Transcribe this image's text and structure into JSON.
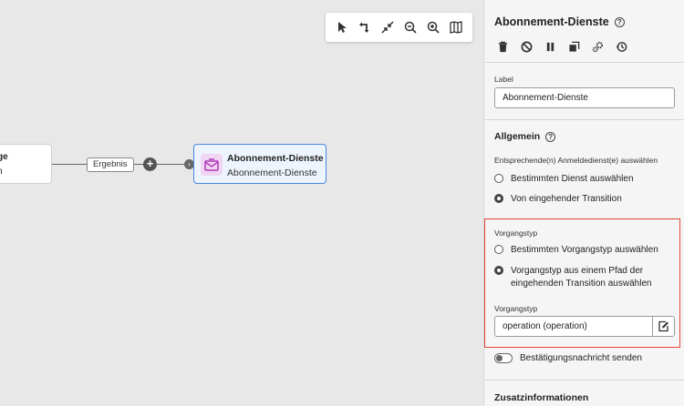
{
  "canvas": {
    "left_node": {
      "line1": "ge",
      "line2": "n"
    },
    "edge_label": "Ergebnis",
    "add_button": "+",
    "incoming_arrow": "›",
    "main_node": {
      "title": "Abonnement-Dienste",
      "subtitle": "Abonnement-Dienste",
      "icon": "envelope-subscription-icon"
    },
    "toolbar": [
      "select-pointer-icon",
      "reroute-icon",
      "collapse-icon",
      "zoom-out-icon",
      "zoom-in-icon",
      "minimap-icon"
    ]
  },
  "panel": {
    "title": "Abonnement-Dienste",
    "help_glyph": "?",
    "actions": [
      "delete-icon",
      "disable-icon",
      "pause-icon",
      "copy-icon",
      "settings-icon",
      "history-icon"
    ],
    "label_field": {
      "label": "Label",
      "value": "Abonnement-Dienste"
    },
    "general": {
      "title": "Allgemein",
      "service_label": "Entsprechende(n) Anmeldedienst(e) auswählen",
      "service_options": [
        {
          "label": "Bestimmten Dienst auswählen",
          "selected": false
        },
        {
          "label": "Von eingehender Transition",
          "selected": true
        }
      ]
    },
    "operation": {
      "title": "Vorgangstyp",
      "options": [
        {
          "label": "Bestimmten Vorgangstyp auswählen",
          "selected": false
        },
        {
          "label_line1": "Vorgangstyp aus einem Pfad der",
          "label_line2": "eingehenden Transition auswählen",
          "selected": true
        }
      ],
      "field_label": "Vorgangstyp",
      "field_value": "operation (operation)"
    },
    "confirmation_toggle": {
      "label": "Bestätigungsnachricht senden",
      "on": false
    },
    "additional": {
      "title": "Zusatzinformationen"
    }
  },
  "colors": {
    "highlight": "#e0473a",
    "node_border": "#4a86e0",
    "node_bg": "#eef4fd",
    "icon_bg": "#f0d6f3",
    "icon_fg": "#b03ab8"
  }
}
